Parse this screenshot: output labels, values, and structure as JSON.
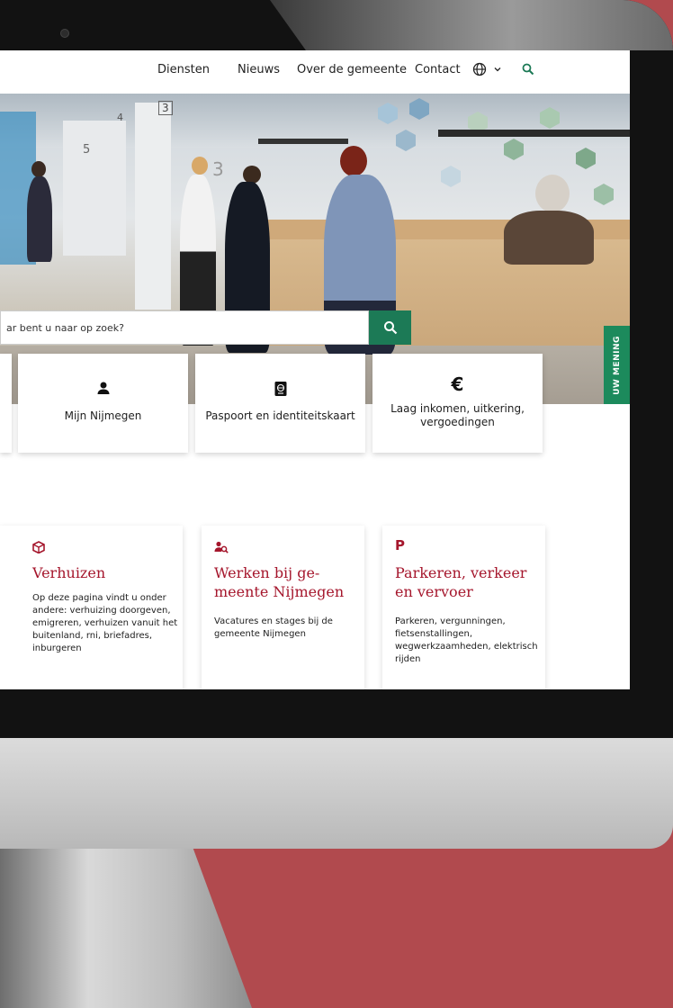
{
  "nav": {
    "items": [
      "Diensten",
      "Nieuws",
      "Over de gemeente",
      "Contact"
    ],
    "language_chevron": "⌄"
  },
  "search": {
    "placeholder": "ar bent u naar op zoek?"
  },
  "feedback_tab": {
    "label": "UW MENING"
  },
  "tiles": [
    {
      "label": "Mijn Nijmegen",
      "icon": "person-icon"
    },
    {
      "label": "Paspoort en identiteitskaart",
      "icon": "passport-icon"
    },
    {
      "label": "Laag inkomen, uitkering, vergoedingen",
      "icon": "euro-icon"
    }
  ],
  "cards": [
    {
      "title": "Verhuizen",
      "icon": "box-icon",
      "description": "Op deze pagina vindt u onder andere: verhuizing doorgeven, emigreren, verhuizen vanuit het buitenland, rni, briefadres, inburgeren"
    },
    {
      "title": "Werken bij ge-meente Nijmegen",
      "icon": "person-search-icon",
      "description": "Vacatures en stages bij de gemeente Nijmegen"
    },
    {
      "title": "Parkeren, verkeer en vervoer",
      "icon": "parking-icon",
      "description": "Parkeren, vergunningen, fietsenstallingen, wegwerkzaamheden, elektrisch rijden"
    }
  ],
  "hero_counter_numbers": [
    "3",
    "4",
    "5",
    "3"
  ],
  "colors": {
    "brand_red": "#a5162c",
    "brand_green": "#1c7a56",
    "background": "#b14a4e"
  }
}
